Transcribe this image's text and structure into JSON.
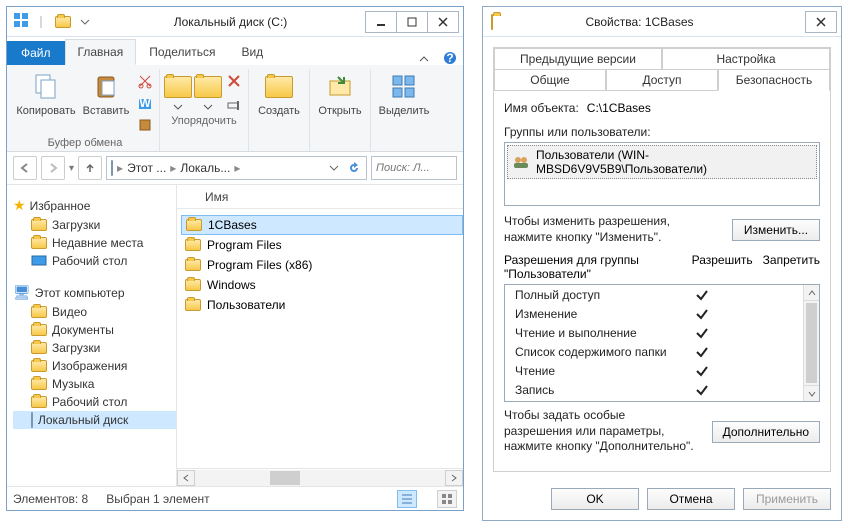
{
  "explorer": {
    "title": "Локальный диск (C:)",
    "tabs": {
      "file": "Файл",
      "home": "Главная",
      "share": "Поделиться",
      "view": "Вид"
    },
    "ribbon": {
      "copy": "Копировать",
      "paste": "Вставить",
      "clipboard_group": "Буфер обмена",
      "organize_group": "Упорядочить",
      "create": "Создать",
      "open": "Открыть",
      "select": "Выделить"
    },
    "address": {
      "part1": "Этот ...",
      "part2": "Локаль..."
    },
    "search_placeholder": "Поиск: Л...",
    "nav": {
      "favorites": "Избранное",
      "fav_items": [
        "Загрузки",
        "Недавние места",
        "Рабочий стол"
      ],
      "thispc": "Этот компьютер",
      "pc_items": [
        "Видео",
        "Документы",
        "Загрузки",
        "Изображения",
        "Музыка",
        "Рабочий стол",
        "Локальный диск"
      ]
    },
    "col_name": "Имя",
    "files": [
      "1CBases",
      "Program Files",
      "Program Files (x86)",
      "Windows",
      "Пользователи"
    ],
    "selected_file_index": 0,
    "status": {
      "count": "Элементов: 8",
      "selected": "Выбран 1 элемент"
    }
  },
  "props": {
    "title": "Свойства: 1CBases",
    "tabs": {
      "prev": "Предыдущие версии",
      "customize": "Настройка",
      "general": "Общие",
      "sharing": "Доступ",
      "security": "Безопасность"
    },
    "object_label": "Имя объекта:",
    "object_value": "C:\\1CBases",
    "groups_label": "Группы или пользователи:",
    "group_item": "Пользователи (WIN-MBSD6V9V5B9\\Пользователи)",
    "edit_hint": "Чтобы изменить разрешения, нажмите кнопку \"Изменить\".",
    "edit_btn": "Изменить...",
    "perm_for": "Разрешения для группы \"Пользователи\"",
    "col_allow": "Разрешить",
    "col_deny": "Запретить",
    "perms": [
      {
        "name": "Полный доступ",
        "allow": true,
        "deny": false
      },
      {
        "name": "Изменение",
        "allow": true,
        "deny": false
      },
      {
        "name": "Чтение и выполнение",
        "allow": true,
        "deny": false
      },
      {
        "name": "Список содержимого папки",
        "allow": true,
        "deny": false
      },
      {
        "name": "Чтение",
        "allow": true,
        "deny": false
      },
      {
        "name": "Запись",
        "allow": true,
        "deny": false
      }
    ],
    "advanced_hint": "Чтобы задать особые разрешения или параметры, нажмите кнопку \"Дополнительно\".",
    "advanced_btn": "Дополнительно",
    "ok": "OK",
    "cancel": "Отмена",
    "apply": "Применить"
  }
}
